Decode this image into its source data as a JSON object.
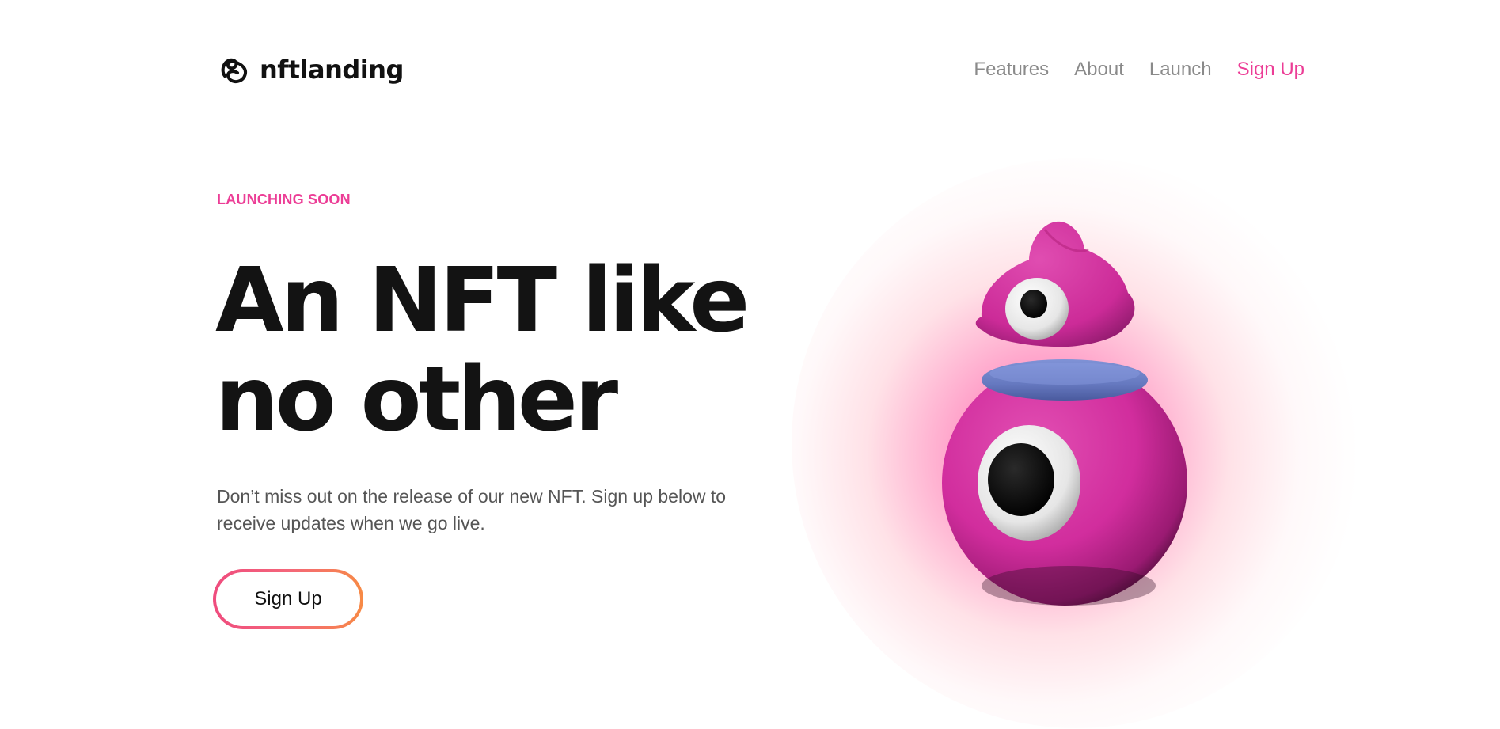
{
  "brand": {
    "name": "nftlanding",
    "icon": "logo-swirl-icon"
  },
  "nav": {
    "items": [
      {
        "label": "Features"
      },
      {
        "label": "About"
      },
      {
        "label": "Launch"
      },
      {
        "label": "Sign Up"
      }
    ]
  },
  "hero": {
    "eyebrow": "LAUNCHING SOON",
    "headline_line1": "An NFT like",
    "headline_line2": "no other",
    "description": "Don’t miss out on the release of our new NFT. Sign up below to receive updates when we go live.",
    "cta_label": "Sign Up",
    "illustration": "pink-one-eyed-creature-illustration"
  },
  "colors": {
    "accent_pink": "#ec3d96",
    "nav_gray": "#8a8a8a",
    "headline": "#131313",
    "cta_gradient_start": "#ef4c7e",
    "cta_gradient_end": "#f78a45",
    "creature_body": "#d12d9d",
    "creature_collar": "#6679c0"
  }
}
